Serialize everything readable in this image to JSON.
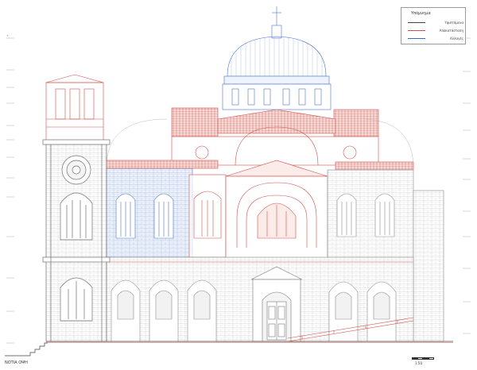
{
  "legend": {
    "title": "Υπόμνημα",
    "items": [
      {
        "label": "Υφιστάμενα",
        "color": "#444444"
      },
      {
        "label": "Αποκατάσταση",
        "color": "#d0504a"
      },
      {
        "label": "Αλλαγές",
        "color": "#3a67c9"
      }
    ]
  },
  "drawing_label": "ΝΟΤΙΑ ΟΨΗ",
  "scale_label": "1:50",
  "colors": {
    "existing": "#8c8c8c",
    "restoration": "#d0504a",
    "changes": "#4a72d0",
    "stone": "#b5b5b5"
  }
}
